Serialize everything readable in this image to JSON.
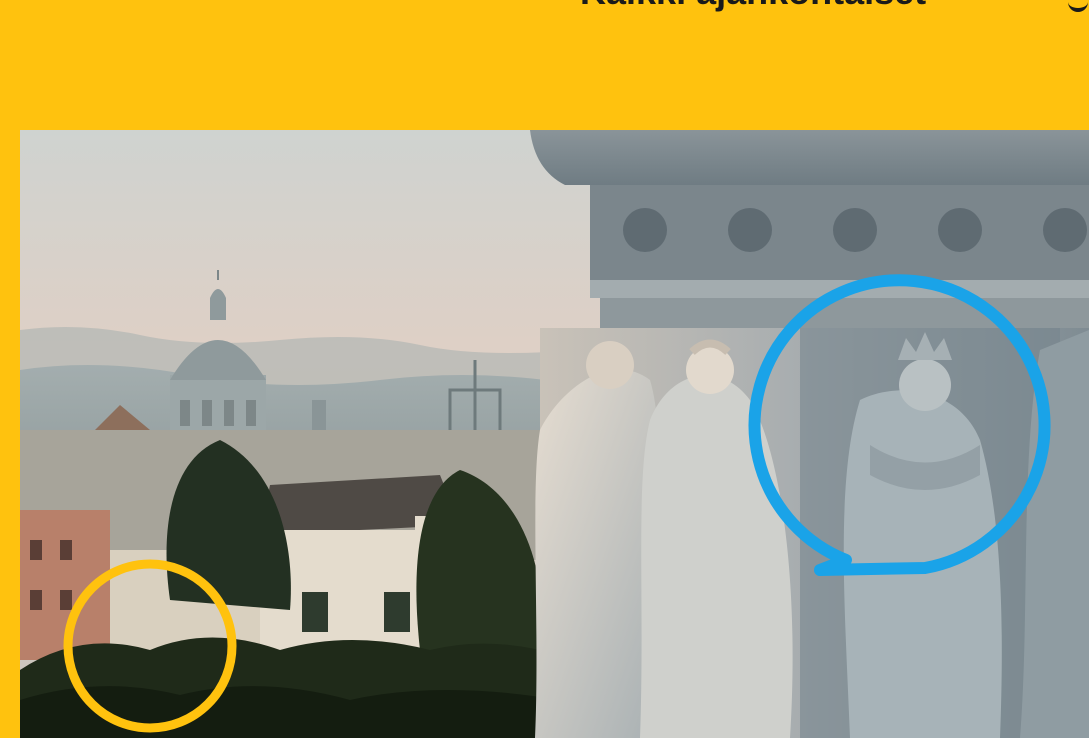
{
  "header": {
    "headline": "Kaikki ajankohtaiset"
  },
  "colors": {
    "brand_yellow": "#FFC20E",
    "speech_bubble_blue": "#1AA3E8",
    "circle_yellow": "#FFC20E",
    "headline_text": "#1a1a1a"
  },
  "hero": {
    "icons": [
      "speech-bubble-icon",
      "circle-ring-icon"
    ]
  }
}
